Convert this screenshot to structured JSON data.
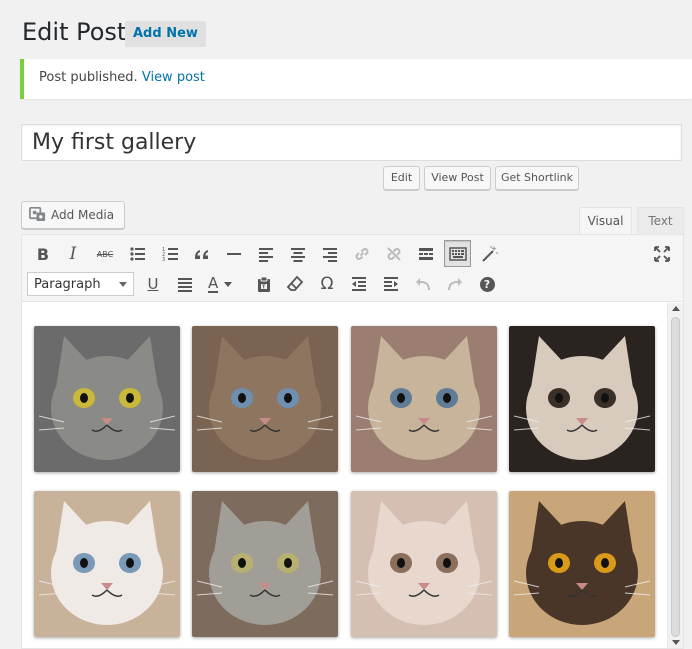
{
  "header": {
    "title": "Edit Post",
    "add_new_label": "Add New"
  },
  "notice": {
    "message": "Post published.",
    "link_label": "View post",
    "accent_color": "#7ad03a"
  },
  "post": {
    "title_value": "My first gallery"
  },
  "permalink_buttons": {
    "edit_label": "Edit",
    "view_post_label": "View Post",
    "shortlink_label": "Get Shortlink"
  },
  "media": {
    "add_media_label": "Add Media",
    "icon": "media-camera-icon"
  },
  "editor_tabs": {
    "visual_label": "Visual",
    "text_label": "Text",
    "active": "Visual"
  },
  "toolbar": {
    "row1": [
      "bold-icon",
      "italic-icon",
      "strikethrough-icon",
      "bullet-list-icon",
      "numbered-list-icon",
      "blockquote-icon",
      "horizontal-line-icon",
      "align-left-icon",
      "align-center-icon",
      "align-right-icon",
      "insert-link-icon",
      "remove-link-icon",
      "read-more-icon",
      "toolbar-toggle-icon",
      "wp-magic-icon",
      "fullscreen-icon"
    ],
    "row2": [
      "underline-icon",
      "justify-icon",
      "text-color-icon",
      "paste-text-icon",
      "clear-formatting-icon",
      "special-character-icon",
      "outdent-icon",
      "indent-icon",
      "undo-icon",
      "redo-icon",
      "help-icon"
    ],
    "format_select_value": "Paragraph",
    "bold_glyph": "B",
    "italic_glyph": "I",
    "strike_glyph": "ABC",
    "underline_glyph": "U",
    "text_color_glyph": "A",
    "omega_glyph": "Ω",
    "help_glyph": "?"
  },
  "gallery": {
    "items": [
      {
        "name": "gallery-image-screaming-tabby-cat",
        "bg": "#6b6b6b",
        "fur": "#8a8a86",
        "eye": "#c9b83a"
      },
      {
        "name": "gallery-image-fluffy-brown-kitten",
        "bg": "#7a6350",
        "fur": "#8d755f",
        "eye": "#6e8fb0"
      },
      {
        "name": "gallery-image-surprised-kitten-in-hand",
        "bg": "#9b7d72",
        "fur": "#c7b49a",
        "eye": "#5e7c95"
      },
      {
        "name": "gallery-image-cat-sticking-out-tongue",
        "bg": "#2a2420",
        "fur": "#d8cbbd",
        "eye": "#3b3028"
      },
      {
        "name": "gallery-image-white-fluffy-kitten",
        "bg": "#c9b29a",
        "fur": "#f0eae6",
        "eye": "#7a98b8"
      },
      {
        "name": "gallery-image-grey-tabby-with-kitten",
        "bg": "#7d6b5e",
        "fur": "#a19e98",
        "eye": "#b8b070"
      },
      {
        "name": "gallery-image-grumpy-persian-cat",
        "bg": "#d4bfb2",
        "fur": "#e7d7cc",
        "eye": "#8a6f5c"
      },
      {
        "name": "gallery-image-brown-cat-orange-eyes",
        "bg": "#c8a67a",
        "fur": "#4a3628",
        "eye": "#d99a1a"
      }
    ]
  }
}
